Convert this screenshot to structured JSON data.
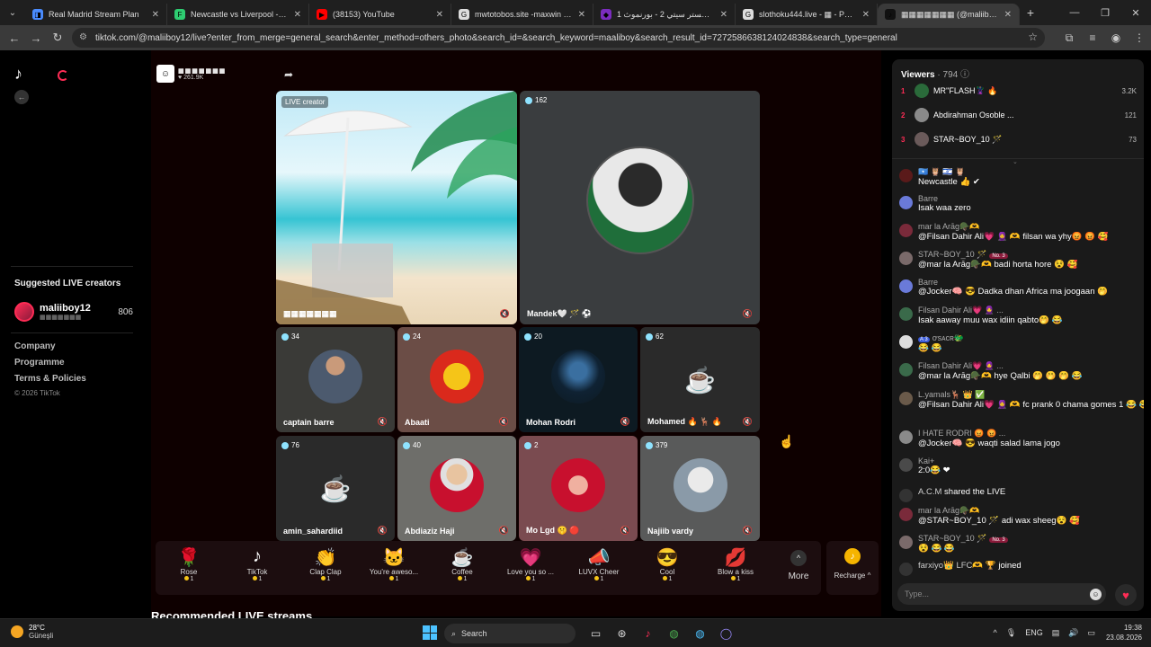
{
  "browser": {
    "tabs": [
      {
        "title": "Real Madrid Stream Plan",
        "fav_color": "#4a8cff",
        "fav_char": "◨"
      },
      {
        "title": "Newcastle vs Liverpool - live sc",
        "fav_color": "#2ecc71",
        "fav_char": "F"
      },
      {
        "title": "(38153) YouTube",
        "fav_color": "#ff0000",
        "fav_char": "▶"
      },
      {
        "title": "mwtotobos.site -maxwin - Pene",
        "fav_color": "#dddddd",
        "fav_char": "G"
      },
      {
        "title": "مانشستر سيتي 2 - بورنموث 1 |",
        "fav_color": "#7b2cbf",
        "fav_char": "◆"
      },
      {
        "title": "slothoku444.live - ▦ - Penelus",
        "fav_color": "#dddddd",
        "fav_char": "G"
      },
      {
        "title": "▦▦▦▦▦▦▦ (@maliiboy1",
        "fav_color": "#111111",
        "fav_char": "♪"
      }
    ],
    "url": "tiktok.com/@maliiboy12/live?enter_from_merge=general_search&enter_method=others_photo&search_id=&search_keyword=maaliboy&search_result_id=7272586638124024838&search_type=general"
  },
  "sidebar": {
    "suggested_title": "Suggested LIVE creators",
    "suggested": {
      "name": "maliiboy12",
      "sub": "▦▦▦▦▦▦▦",
      "count": "806"
    },
    "links": [
      "Company",
      "Programme",
      "Terms & Policies"
    ],
    "copyright": "© 2026 TikTok"
  },
  "host": {
    "name": "▦▦▦▦▦▦▦",
    "likes": "♥ 261.9K"
  },
  "tiles": [
    {
      "badge": "LIVE creator",
      "name": "▦▦▦▦▦▦▦",
      "live": true
    },
    {
      "badge": "162",
      "name": "Mandek🤍 🪄 ⚽"
    },
    {
      "badge": "34",
      "name": "captain barre"
    },
    {
      "badge": "24",
      "name": "Abaati"
    },
    {
      "badge": "20",
      "name": "Mohan Rodri"
    },
    {
      "badge": "62",
      "name": "Mohamed 🔥 🦌 🔥"
    },
    {
      "badge": "76",
      "name": "amin_sahardiid"
    },
    {
      "badge": "40",
      "name": "Abdiaziz Haji"
    },
    {
      "badge": "2",
      "name": "Mo Lgd 🤫 🔴"
    },
    {
      "badge": "379",
      "name": "Najiib vardy"
    }
  ],
  "gifts": [
    {
      "name": "Rose",
      "icon": "🌹",
      "price": "1"
    },
    {
      "name": "TikTok",
      "icon": "♪",
      "price": "1"
    },
    {
      "name": "Clap Clap",
      "icon": "👏",
      "price": "1"
    },
    {
      "name": "You're aweso...",
      "icon": "🐱",
      "price": "1"
    },
    {
      "name": "Coffee",
      "icon": "☕",
      "price": "1"
    },
    {
      "name": "Love you so ...",
      "icon": "💗",
      "price": "1"
    },
    {
      "name": "LUVX Cheer",
      "icon": "📣",
      "price": "1"
    },
    {
      "name": "Cool",
      "icon": "😎",
      "price": "1"
    },
    {
      "name": "Blow a kiss",
      "icon": "💋",
      "price": "1"
    }
  ],
  "more_label": "More",
  "recharge_label": "Recharge ^",
  "recommended_title": "Recommended LIVE streams",
  "chat": {
    "viewers_label": "Viewers",
    "viewers_count": "· 794",
    "top_viewers": [
      {
        "rank": "1",
        "name": "MR''FLASH🦹🏽 🔥",
        "score": "3.2K"
      },
      {
        "rank": "2",
        "name": "Abdirahman Osoble ...",
        "score": "121"
      },
      {
        "rank": "3",
        "name": "STAR~BOY_10 🪄",
        "score": "73"
      }
    ],
    "messages": [
      {
        "user": "🇸🇴 🦉 🇮🇱 🦉",
        "text": "Newcastle 👍 ✔"
      },
      {
        "user": "Barre",
        "text": "Isak waa zero"
      },
      {
        "user": "mar la Arāg🪖🫶",
        "text": "@Filsan Dahir Ali💗 🧕 🫶 filsan wa yhy😡 😡 🥰"
      },
      {
        "user": "STAR~BOY_10 🪄",
        "badge": "No. 3",
        "text": "@mar la Arāg🪖🫶 badi horta hore 😵 🥰"
      },
      {
        "user": "Barre",
        "text": "@Jocker🧠 😎 Dadka dhan Africa ma joogaan 🤭"
      },
      {
        "user": "Filsan Dahir Ali💗 🧕 ...",
        "text": "Isak aaway muu wax idiin qabto🤭 😂"
      },
      {
        "user": "ơsᴀcʀ🐲",
        "level": "A 3",
        "text": "😂 😂"
      },
      {
        "user": "Filsan Dahir Ali💗 🧕 ...",
        "text": "@mar la Arāg🪖🫶 hye Qalbi 🤭 🤭 🤭 😂"
      },
      {
        "user": "L.yamals🦌 👑 ✅",
        "text": "@Filsan Dahir Ali💗 🧕 🫶 fc prank 0 chama gomes 1 😂 😂 😂"
      },
      {
        "user": "I HATE RODRI 😡 😡 ...",
        "text": "@Jocker🧠 😎 waqti salad lama jogo"
      },
      {
        "user": "Kai+",
        "text": "2:0😂 ❤"
      },
      {
        "user": "A.C.M",
        "text": "shared the LIVE"
      },
      {
        "user": "mar la Arāg🪖🫶",
        "text": "@STAR~BOY_10 🪄 adi wax sheeg😵 🥰"
      },
      {
        "user": "STAR~BOY_10 🪄",
        "badge": "No. 3",
        "text": "😵 😂 😂"
      },
      {
        "user": "farxiyo👑 LFC🫶 🏆",
        "text": "joined"
      }
    ],
    "input_placeholder": "Type..."
  },
  "taskbar": {
    "temp": "28°C",
    "condition": "Güneşli",
    "search": "Search",
    "lang": "ENG",
    "time": "19:38",
    "date": "23.08.2026"
  }
}
